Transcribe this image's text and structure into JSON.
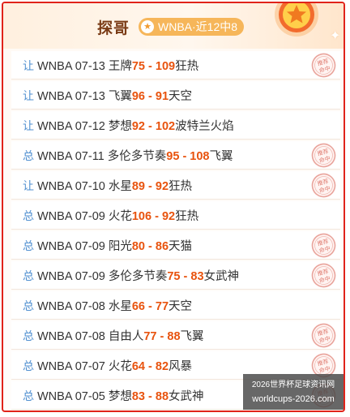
{
  "header": {
    "title": "探哥",
    "badge_label": "WNBA·近12中8"
  },
  "stamp_text": "推荐命中",
  "rows": [
    {
      "type": "让",
      "league": "WNBA",
      "date": "07-13",
      "home": "王牌",
      "score": "75 - 109",
      "away": "狂热",
      "hit": true
    },
    {
      "type": "让",
      "league": "WNBA",
      "date": "07-13",
      "home": "飞翼",
      "score": "96 - 91",
      "away": "天空",
      "hit": false
    },
    {
      "type": "让",
      "league": "WNBA",
      "date": "07-12",
      "home": "梦想",
      "score": "92 - 102",
      "away": "波特兰火焰",
      "hit": false
    },
    {
      "type": "总",
      "league": "WNBA",
      "date": "07-11",
      "home": "多伦多节奏",
      "score": "95 - 108",
      "away": "飞翼",
      "hit": true
    },
    {
      "type": "让",
      "league": "WNBA",
      "date": "07-10",
      "home": "水星",
      "score": "89 - 92",
      "away": "狂热",
      "hit": true
    },
    {
      "type": "总",
      "league": "WNBA",
      "date": "07-09",
      "home": "火花",
      "score": "106 - 92",
      "away": "狂热",
      "hit": false
    },
    {
      "type": "总",
      "league": "WNBA",
      "date": "07-09",
      "home": "阳光",
      "score": "80 - 86",
      "away": "天猫",
      "hit": true
    },
    {
      "type": "总",
      "league": "WNBA",
      "date": "07-09",
      "home": "多伦多节奏",
      "score": "75 - 83",
      "away": "女武神",
      "hit": true
    },
    {
      "type": "总",
      "league": "WNBA",
      "date": "07-08",
      "home": "水星",
      "score": "66 - 77",
      "away": "天空",
      "hit": false
    },
    {
      "type": "总",
      "league": "WNBA",
      "date": "07-08",
      "home": "自由人",
      "score": "77 - 88",
      "away": "飞翼",
      "hit": true
    },
    {
      "type": "总",
      "league": "WNBA",
      "date": "07-07",
      "home": "火花",
      "score": "64 - 82",
      "away": "风暴",
      "hit": true
    },
    {
      "type": "总",
      "league": "WNBA",
      "date": "07-05",
      "home": "梦想",
      "score": "83 - 88",
      "away": "女武神",
      "hit": true
    }
  ],
  "watermark": {
    "line1": "2026世界杯足球资讯网",
    "line2": "worldcups-2026.com"
  }
}
